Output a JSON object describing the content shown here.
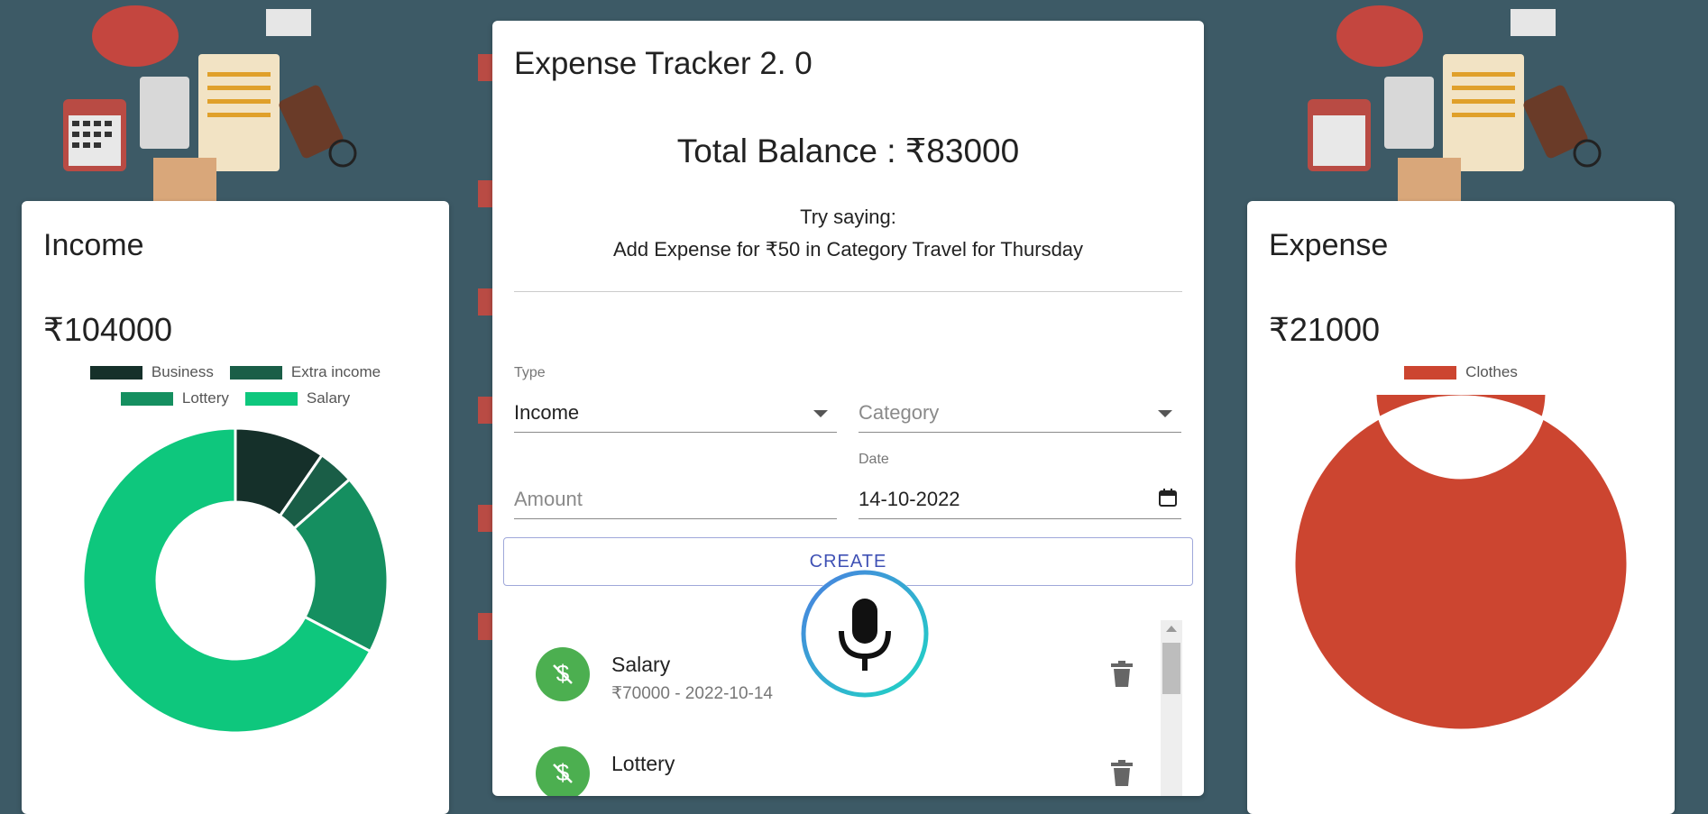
{
  "colors": {
    "background": "#3d5a66",
    "income_series": [
      "#15302a",
      "#1a5e47",
      "#158f60",
      "#0ec77d"
    ],
    "expense_series": [
      "#cc4530"
    ],
    "accent": "#3f51b5",
    "avatar_income": "#4caf50"
  },
  "income": {
    "title": "Income",
    "amount": "₹104000",
    "legend": [
      "Business",
      "Extra income",
      "Lottery",
      "Salary"
    ]
  },
  "expense": {
    "title": "Expense",
    "amount": "₹21000",
    "legend": [
      "Clothes"
    ]
  },
  "main": {
    "title": "Expense Tracker 2. 0",
    "balance": "Total Balance : ₹83000",
    "hint_line1": "Try saying:",
    "hint_line2": "Add Expense for ₹50 in Category Travel for Thursday",
    "form": {
      "type_label": "Type",
      "type_value": "Income",
      "category_placeholder": "Category",
      "amount_placeholder": "Amount",
      "date_label": "Date",
      "date_value": "14-10-2022",
      "create_label": "CREATE"
    },
    "transactions": [
      {
        "title": "Salary",
        "subtitle": "₹70000 - 2022-10-14",
        "icon": "dollar-icon"
      },
      {
        "title": "Lottery",
        "subtitle": "",
        "icon": "dollar-icon"
      }
    ]
  },
  "chart_data": [
    {
      "type": "pie",
      "title": "",
      "categories": [
        "Business",
        "Extra income",
        "Lottery",
        "Salary"
      ],
      "values": [
        10000,
        4000,
        20000,
        70000
      ],
      "legend": "top",
      "donut": true
    },
    {
      "type": "pie",
      "title": "",
      "categories": [
        "Clothes"
      ],
      "values": [
        21000
      ],
      "legend": "top",
      "donut": true
    }
  ]
}
